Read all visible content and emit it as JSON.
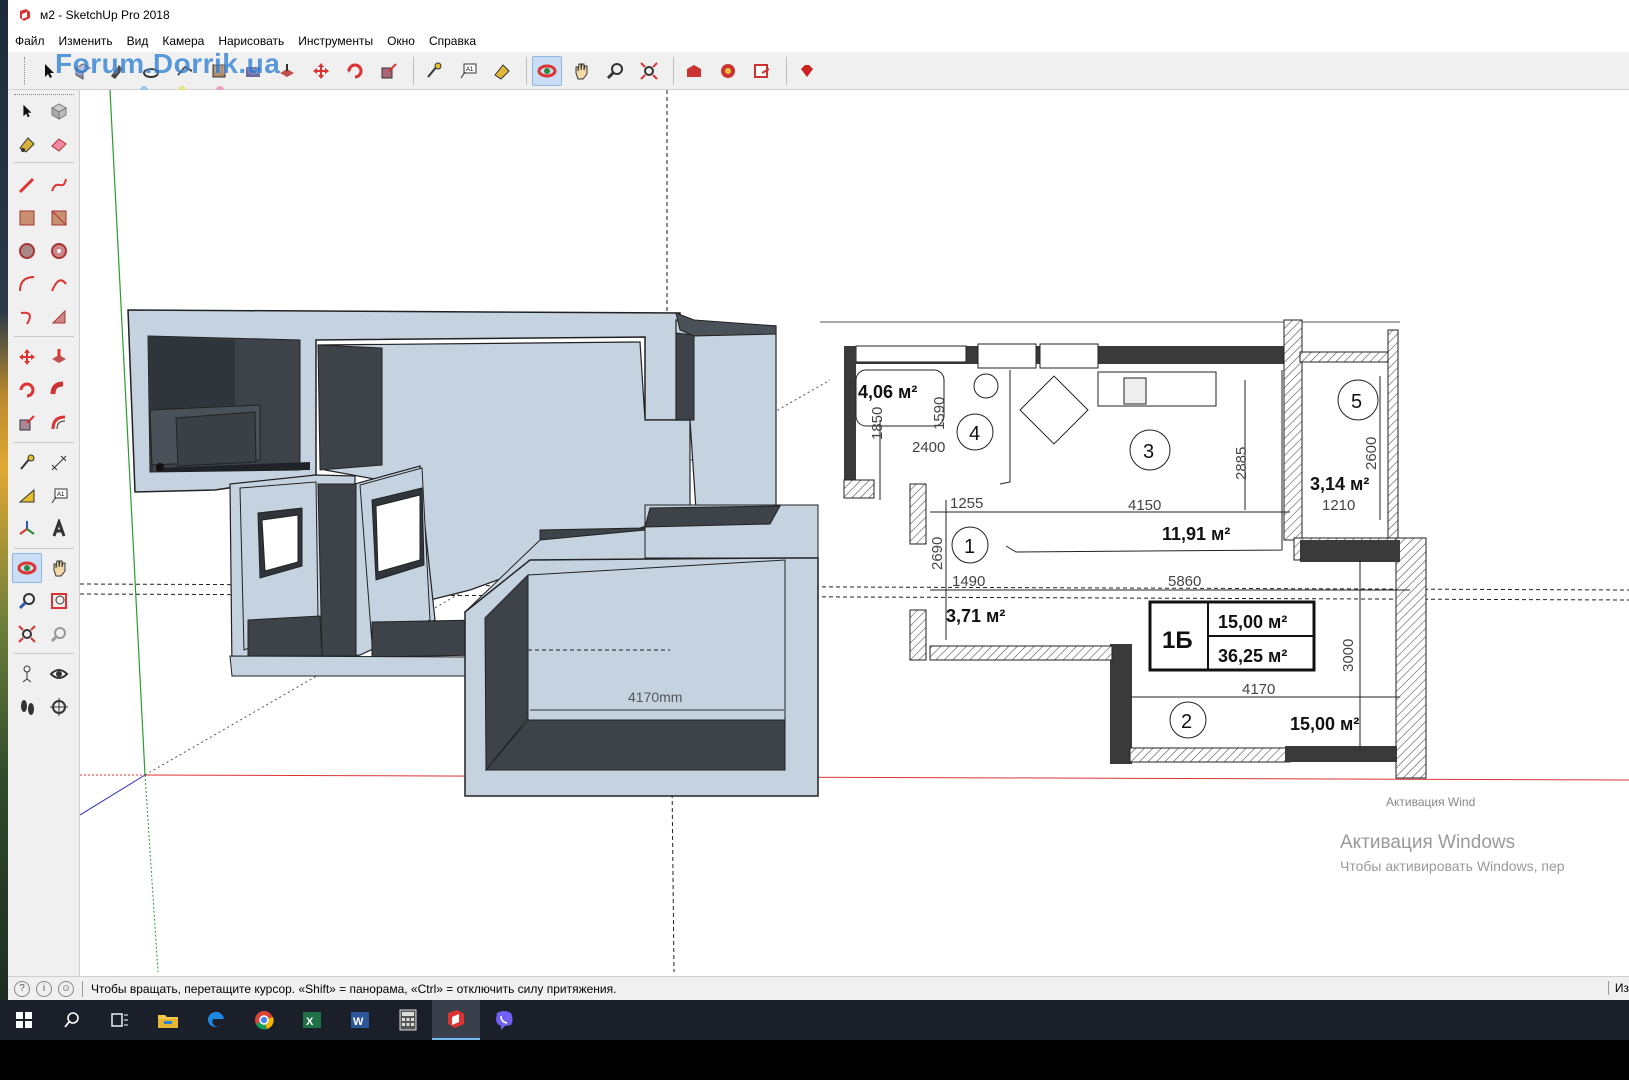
{
  "window": {
    "title": "м2 - SketchUp Pro 2018"
  },
  "menu": [
    "Файл",
    "Изменить",
    "Вид",
    "Камера",
    "Нарисовать",
    "Инструменты",
    "Окно",
    "Справка"
  ],
  "watermark": "Forum.Dorrik.ua",
  "toolbar_icons": [
    "select-icon",
    "make-component-icon",
    "paint-bucket-icon",
    "eraser-icon",
    "line-icon",
    "rectangle-icon",
    "circle-icon",
    "push-pull-icon",
    "move-icon",
    "rotate-icon",
    "scale-icon",
    "tape-measure-icon",
    "text-icon",
    "paint-icon",
    "orbit-icon",
    "pan-icon",
    "zoom-icon",
    "zoom-extents-icon",
    "warehouse-icon",
    "extension-warehouse-icon",
    "layout-icon",
    "ruby-icon"
  ],
  "model": {
    "dimension_label": "4170mm"
  },
  "plan": {
    "areas": [
      "4,06 м²",
      "11,91 м²",
      "3,14 м²",
      "3,71 м²",
      "15,00 м²"
    ],
    "room_numbers": [
      "1",
      "2",
      "3",
      "4",
      "5"
    ],
    "dims": [
      "2400",
      "1590",
      "1850",
      "1255",
      "4150",
      "2885",
      "2600",
      "1210",
      "2690",
      "1490",
      "5860",
      "3000",
      "4170"
    ],
    "summary": {
      "id": "1Б",
      "area1": "15,00 м²",
      "area2": "36,25 м²"
    },
    "faded_text": "Активация Wind"
  },
  "status": {
    "hint": "Чтобы вращать, перетащите курсор. «Shift» = панорама, «Ctrl» = отключить силу притяжения.",
    "right": "Из"
  },
  "activation": {
    "title": "Активация Windows",
    "subtitle": "Чтобы активировать Windows, пер"
  },
  "taskbar": [
    "start-icon",
    "search-icon",
    "task-view-icon",
    "file-explorer-icon",
    "edge-icon",
    "chrome-icon",
    "excel-icon",
    "word-icon",
    "calculator-icon",
    "sketchup-icon",
    "viber-icon"
  ]
}
